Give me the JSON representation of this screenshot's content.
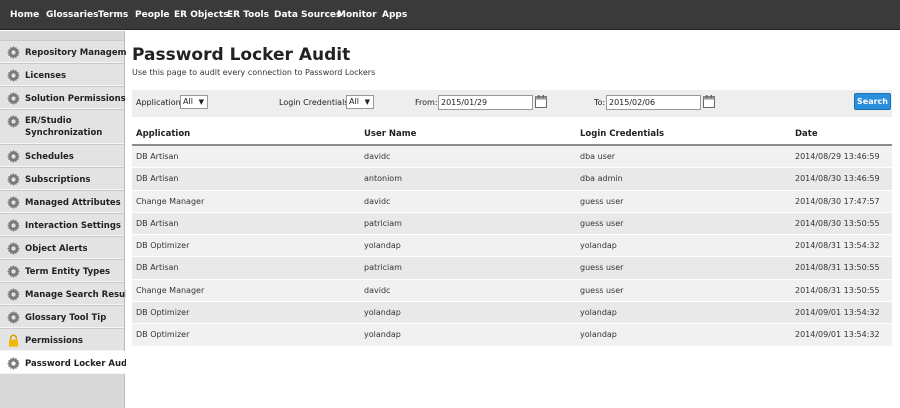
{
  "topnav": {
    "items": [
      "Home",
      "Glossaries",
      "Terms",
      "People",
      "ER Objects",
      "ER Tools",
      "Data Sources",
      "Monitor",
      "Apps"
    ]
  },
  "sidebar": {
    "items": [
      {
        "label": "Repository Management",
        "icon": "gear-icon"
      },
      {
        "label": "Licenses",
        "icon": "gear-icon"
      },
      {
        "label": "Solution Permissions",
        "icon": "gear-icon"
      },
      {
        "label": "ER/Studio Synchronization",
        "line1": "ER/Studio",
        "line2": "Synchronization",
        "icon": "gear-icon"
      },
      {
        "label": "Schedules",
        "icon": "gear-icon"
      },
      {
        "label": "Subscriptions",
        "icon": "gear-icon"
      },
      {
        "label": "Managed Attributes",
        "icon": "gear-icon"
      },
      {
        "label": "Interaction Settings",
        "icon": "gear-icon"
      },
      {
        "label": "Object Alerts",
        "icon": "gear-icon"
      },
      {
        "label": "Term Entity Types",
        "icon": "gear-icon"
      },
      {
        "label": "Manage Search Results",
        "icon": "gear-icon"
      },
      {
        "label": "Glossary Tool Tip",
        "icon": "gear-icon"
      },
      {
        "label": "Permissions",
        "icon": "lock-icon"
      },
      {
        "label": "Password Locker Audit",
        "icon": "gear-icon",
        "active": true
      }
    ]
  },
  "page": {
    "title": "Password Locker Audit",
    "subtitle": "Use this page to audit every connection to Password Lockers"
  },
  "filters": {
    "application_label": "Application:",
    "application_value": "All",
    "credentials_label": "Login Credentials:",
    "credentials_value": "All",
    "from_label": "From:",
    "from_value": "2015/01/29",
    "to_label": "To:",
    "to_value": "2015/02/06",
    "search_label": "Search"
  },
  "table": {
    "headers": [
      "Application",
      "User Name",
      "Login Credentials",
      "Date"
    ],
    "rows": [
      [
        "DB Artisan",
        "davidc",
        "dba user",
        "2014/08/29 13:46:59"
      ],
      [
        "DB Artisan",
        "antoniom",
        "dba admin",
        "2014/08/30 13:46:59"
      ],
      [
        "Change Manager",
        "davidc",
        "guess user",
        "2014/08/30 17:47:57"
      ],
      [
        "DB Artisan",
        "patriciam",
        "guess user",
        "2014/08/30 13:50:55"
      ],
      [
        "DB Optimizer",
        "yolandap",
        "yolandap",
        "2014/08/31 13:54:32"
      ],
      [
        "DB Artisan",
        "patriciam",
        "guess user",
        "2014/08/31 13:50:55"
      ],
      [
        "Change Manager",
        "davidc",
        "guess user",
        "2014/08/31 13:50:55"
      ],
      [
        "DB Optimizer",
        "yolandap",
        "yolandap",
        "2014/09/01 13:54:32"
      ],
      [
        "DB Optimizer",
        "yolandap",
        "yolandap",
        "2014/09/01 13:54:32"
      ]
    ]
  },
  "colors": {
    "topnav_bg": "#3a3a3a",
    "sidebar_bg": "#d9d9d9",
    "search_button": "#2a8fdc",
    "lock_icon": "#f2b705"
  }
}
